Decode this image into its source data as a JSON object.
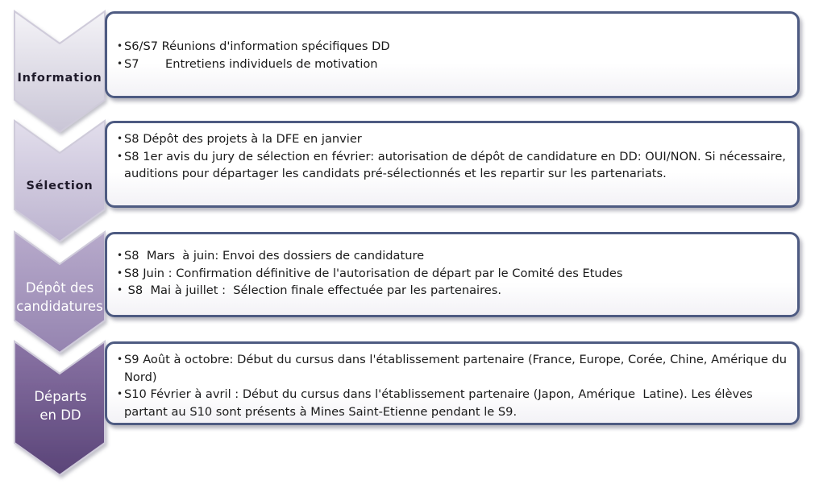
{
  "steps": [
    {
      "label": "Information",
      "fill_top": "#f4f3f7",
      "fill_bottom": "#c9c5d6",
      "bullets": [
        "S6/S7 Réunions d'information spécifiques DD",
        "S7       Entretiens individuels de motivation"
      ]
    },
    {
      "label": "Sélection",
      "fill_top": "#e2deec",
      "fill_bottom": "#bcb3cf",
      "bullets": [
        "S8 Dépôt des projets à la DFE en janvier",
        "S8 1er avis du jury de sélection en février: autorisation de dépôt de candidature en DD: OUI/NON. Si nécessaire, auditions pour départager les candidats pré-sélectionnés et les repartir sur les partenariats."
      ]
    },
    {
      "label": "Dépôt des candidatures",
      "fill_top": "#b7aacb",
      "fill_bottom": "#9584b0",
      "bullets": [
        "S8  Mars  à juin: Envoi des dossiers de candidature",
        "S8 Juin : Confirmation définitive de l'autorisation de départ par le Comité des Etudes",
        " S8  Mai à juillet :  Sélection finale effectuée par les partenaires."
      ]
    },
    {
      "label": "Départs en DD",
      "fill_top": "#8a74a5",
      "fill_bottom": "#5a4478",
      "bullets": [
        "S9 Août à octobre: Début du cursus dans l'établissement partenaire (France, Europe, Corée, Chine, Amérique du Nord)",
        "S10 Février à avril : Début du cursus dans l'établissement partenaire (Japon, Amérique  Latine). Les élèves partant au S10 sont présents à Mines Saint-Etienne pendant le S9."
      ]
    }
  ],
  "colors": {
    "box_border": "#4e5b82",
    "chevron_border": "#cfcbda"
  }
}
